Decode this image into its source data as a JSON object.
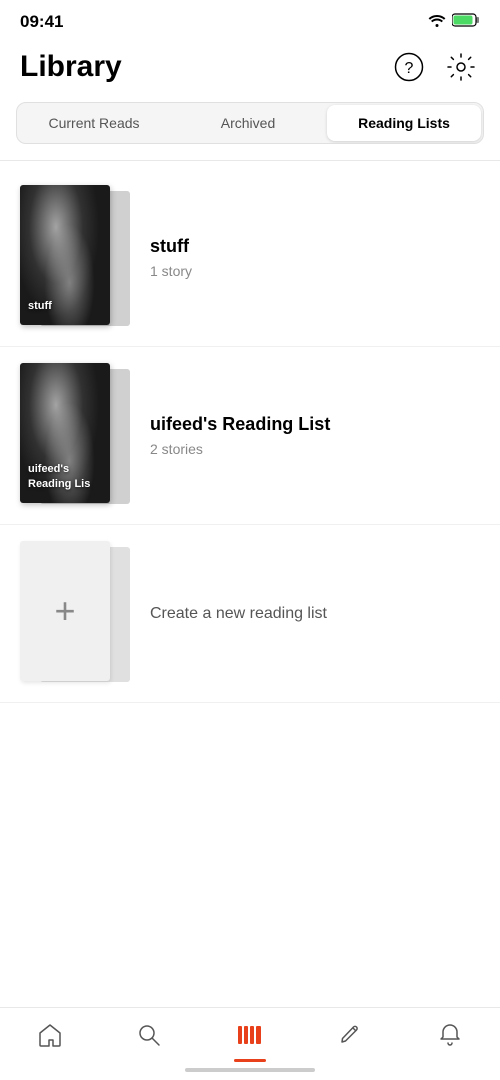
{
  "statusBar": {
    "time": "09:41"
  },
  "header": {
    "title": "Library",
    "helpLabel": "help",
    "settingsLabel": "settings"
  },
  "tabs": [
    {
      "id": "current",
      "label": "Current Reads",
      "active": false
    },
    {
      "id": "archived",
      "label": "Archived",
      "active": false
    },
    {
      "id": "reading-lists",
      "label": "Reading Lists",
      "active": true
    }
  ],
  "readingLists": [
    {
      "id": "stuff",
      "title": "stuff",
      "subtitle": "1 story",
      "coverLabel": "stuff",
      "hasImage": true
    },
    {
      "id": "uifeed",
      "title": "uifeed's Reading List",
      "subtitle": "2 stories",
      "coverLabel": "uifeed's Reading Lis",
      "hasImage": true
    }
  ],
  "createItem": {
    "label": "Create a new reading list"
  },
  "bottomNav": [
    {
      "id": "home",
      "icon": "home",
      "active": false
    },
    {
      "id": "search",
      "icon": "search",
      "active": false
    },
    {
      "id": "library",
      "icon": "library",
      "active": true
    },
    {
      "id": "edit",
      "icon": "edit",
      "active": false
    },
    {
      "id": "notifications",
      "icon": "bell",
      "active": false
    }
  ],
  "colors": {
    "accent": "#e8401a",
    "tabActiveBg": "#ffffff",
    "tabInactiveBg": "#f5f5f5"
  }
}
